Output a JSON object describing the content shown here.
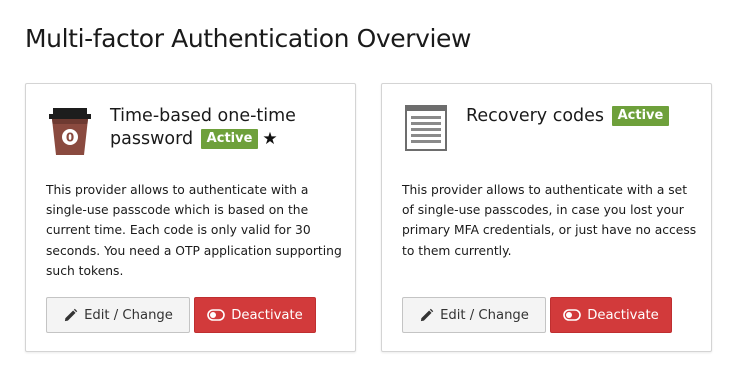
{
  "page": {
    "title": "Multi-factor Authentication Overview"
  },
  "colors": {
    "active_badge": "#6ea03b",
    "deactivate_button": "#d23a3b",
    "card_border": "#d4d4d4"
  },
  "providers": [
    {
      "title": "Time-based one-time password",
      "status": "Active",
      "is_default_marker": "★",
      "icon": "totp-cup-icon",
      "description": "This provider allows to authenticate with a single-use passcode which is based on the current time. Each code is only valid for 30 seconds. You need a OTP application supporting such tokens.",
      "edit_label": "Edit / Change",
      "edit_icon": "pencil-icon",
      "deactivate_label": "Deactivate",
      "deactivate_icon": "toggle-off-icon"
    },
    {
      "title": "Recovery codes",
      "status": "Active",
      "icon": "recovery-codes-icon",
      "description": "This provider allows to authenticate with a set of single-use passcodes, in case you lost your primary MFA credentials, or just have no access to them currently.",
      "edit_label": "Edit / Change",
      "edit_icon": "pencil-icon",
      "deactivate_label": "Deactivate",
      "deactivate_icon": "toggle-off-icon"
    }
  ]
}
